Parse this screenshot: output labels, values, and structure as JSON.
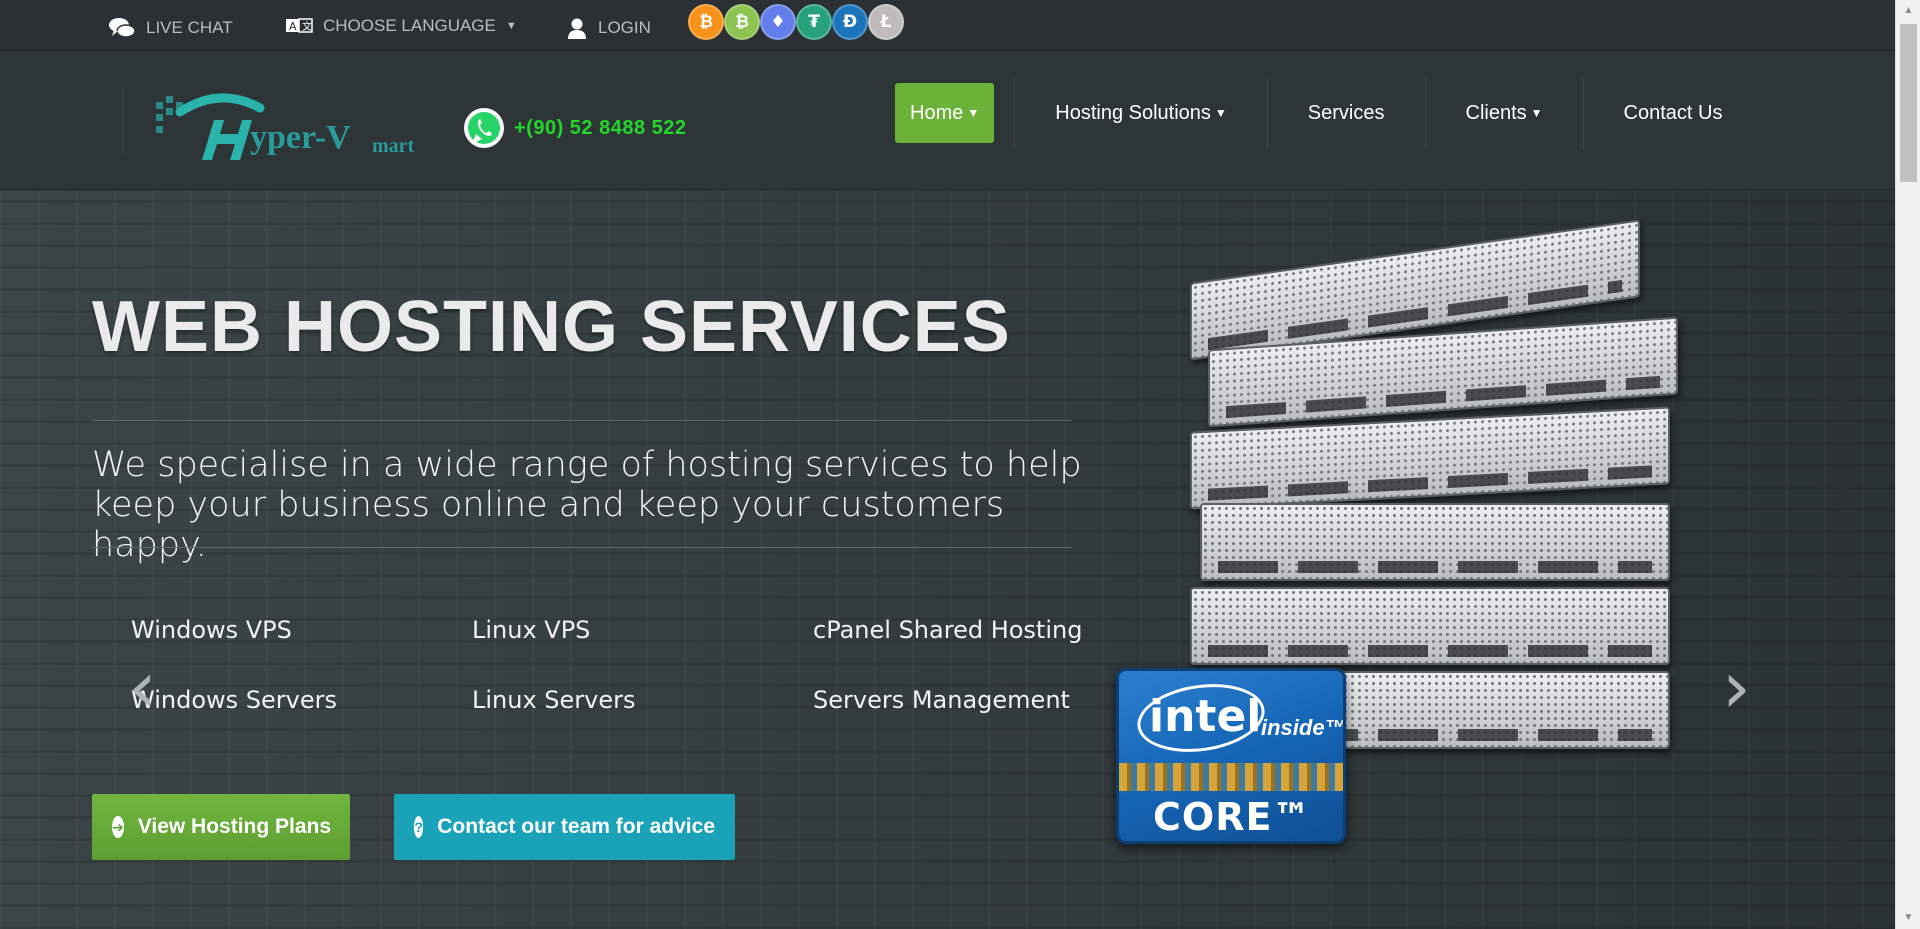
{
  "topbar": {
    "live_chat": "LIVE CHAT",
    "choose_language": "CHOOSE LANGUAGE",
    "login": "LOGIN",
    "crypto": [
      {
        "name": "bitcoin",
        "glyph": "₿",
        "color": "#f7931a"
      },
      {
        "name": "bitcoin-cash",
        "glyph": "₿",
        "color": "#8dc351"
      },
      {
        "name": "ethereum",
        "glyph": "♦",
        "color": "#627eea"
      },
      {
        "name": "tether",
        "glyph": "₮",
        "color": "#26a17b"
      },
      {
        "name": "dash",
        "glyph": "Đ",
        "color": "#1c75bc"
      },
      {
        "name": "litecoin",
        "glyph": "Ł",
        "color": "#bfbbbb"
      }
    ]
  },
  "header": {
    "phone": "+(90) 52 8488 522"
  },
  "nav": {
    "home": "Home",
    "hosting_solutions": "Hosting Solutions",
    "services": "Services",
    "clients": "Clients",
    "contact": "Contact Us"
  },
  "hero": {
    "title": "WEB HOSTING SERVICES",
    "subtitle": "We specialise in a wide range of hosting services to help keep your business online and keep your customers happy.",
    "services": [
      "Windows VPS",
      "Linux VPS",
      "cPanel Shared Hosting",
      "Windows Servers",
      "Linux Servers",
      "Servers Management"
    ],
    "btn_plans": "View Hosting Plans",
    "btn_contact": "Contact our team for advice"
  },
  "colors": {
    "accent_green": "#6ab238",
    "accent_teal": "#1aa2b8",
    "phone_green": "#22d72a"
  }
}
